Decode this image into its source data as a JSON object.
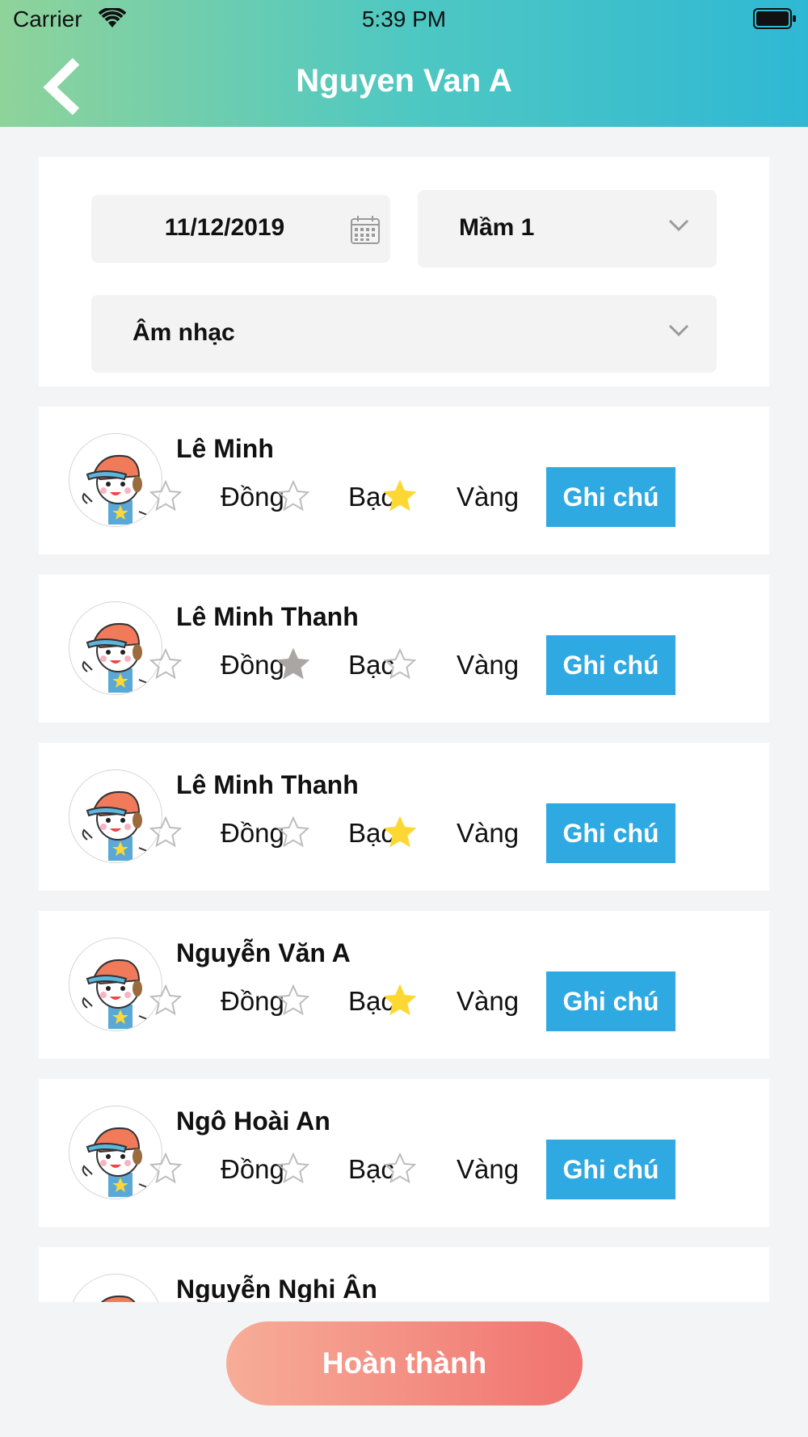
{
  "status_bar": {
    "carrier": "Carrier",
    "time": "5:39 PM"
  },
  "header": {
    "title": "Nguyen Van A"
  },
  "filters": {
    "date": "11/12/2019",
    "class": "Mầm 1",
    "subject": "Âm nhạc"
  },
  "rating_labels": [
    "Đồng",
    "Bạc",
    "Vàng"
  ],
  "note_label": "Ghi chú",
  "students": [
    {
      "name": "Lê Minh",
      "rating": "Vàng"
    },
    {
      "name": "Lê Minh Thanh",
      "rating": "Bạc"
    },
    {
      "name": "Lê Minh Thanh",
      "rating": "Vàng"
    },
    {
      "name": "Nguyễn Văn A",
      "rating": "Vàng"
    },
    {
      "name": "Ngô Hoài An",
      "rating": ""
    },
    {
      "name": "Nguyễn Nghi Ân",
      "rating": ""
    }
  ],
  "colors": {
    "gold": "#fdd835",
    "silver": "#a9a6a3",
    "accent": "#2ea9e2"
  },
  "complete_label": "Hoàn thành"
}
